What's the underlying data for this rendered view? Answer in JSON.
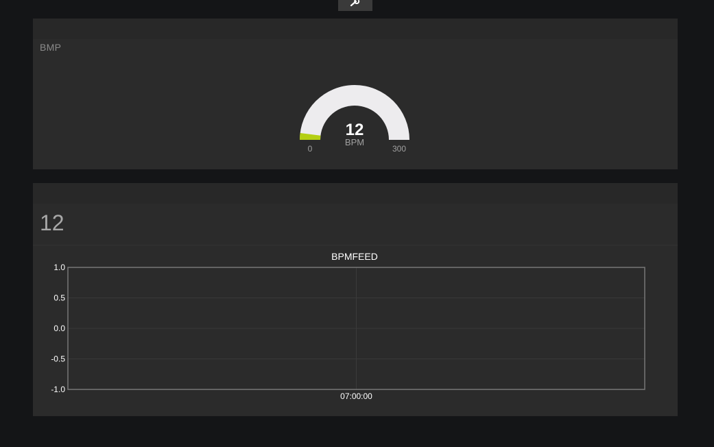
{
  "toolbar": {
    "tool_icon": "wrench-icon"
  },
  "gauge_pane": {
    "title": "BMP",
    "value": "12",
    "units": "BPM",
    "min_label": "0",
    "max_label": "300",
    "level": 0.04,
    "colors": {
      "track": "#edecee",
      "fill": "#b4cf13",
      "value_text": "#ffffff",
      "units_text": "#a0a0a0"
    }
  },
  "chart_pane": {
    "big_value": "12"
  },
  "chart_data": {
    "type": "line",
    "title": "BPMFEED",
    "xlabel": "",
    "ylabel": "",
    "x_ticks": [
      "07:00:00"
    ],
    "y_ticks": [
      "1.0",
      "0.5",
      "0.0",
      "-0.5",
      "-1.0"
    ],
    "ylim": [
      -1.0,
      1.0
    ],
    "grid": true,
    "series": []
  }
}
